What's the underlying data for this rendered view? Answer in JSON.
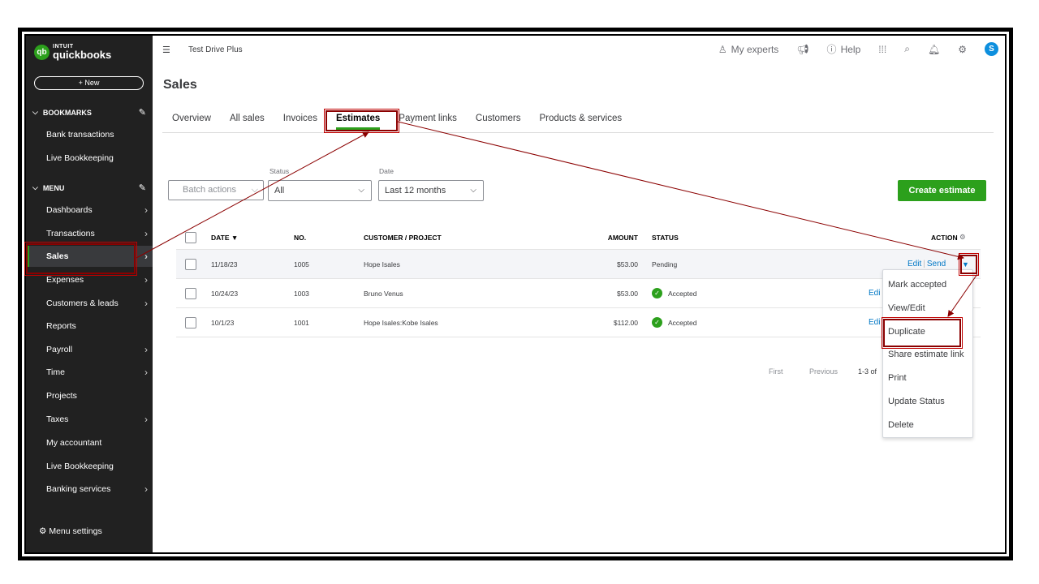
{
  "sidebar": {
    "brand_top": "INTUIT",
    "brand_name": "quickbooks",
    "brand_mark": "qb",
    "new_label": "+ New",
    "bookmarks_label": "BOOKMARKS",
    "bookmarks": [
      "Bank transactions",
      "Live Bookkeeping"
    ],
    "menu_label": "MENU",
    "items": [
      {
        "label": "Dashboards",
        "arrow": true
      },
      {
        "label": "Transactions",
        "arrow": true
      },
      {
        "label": "Sales",
        "arrow": true,
        "active": true
      },
      {
        "label": "Expenses",
        "arrow": true
      },
      {
        "label": "Customers & leads",
        "arrow": true
      },
      {
        "label": "Reports",
        "arrow": false
      },
      {
        "label": "Payroll",
        "arrow": true
      },
      {
        "label": "Time",
        "arrow": true
      },
      {
        "label": "Projects",
        "arrow": false
      },
      {
        "label": "Taxes",
        "arrow": true
      },
      {
        "label": "My accountant",
        "arrow": false
      },
      {
        "label": "Live Bookkeeping",
        "arrow": false
      },
      {
        "label": "Banking services",
        "arrow": true
      }
    ],
    "menu_settings": "Menu settings"
  },
  "topbar": {
    "company": "Test Drive Plus",
    "my_experts": "My experts",
    "help": "Help",
    "avatar_letter": "S"
  },
  "page": {
    "title": "Sales",
    "tabs": [
      "Overview",
      "All sales",
      "Invoices",
      "Estimates",
      "Payment links",
      "Customers",
      "Products & services"
    ],
    "active_tab": "Estimates"
  },
  "filters": {
    "batch_actions": "Batch actions",
    "status_label": "Status",
    "status_value": "All",
    "date_label": "Date",
    "date_value": "Last 12 months",
    "create_button": "Create estimate"
  },
  "table": {
    "headers": {
      "date": "DATE ▼",
      "no": "NO.",
      "customer": "CUSTOMER / PROJECT",
      "amount": "AMOUNT",
      "status": "STATUS",
      "action": "ACTION"
    },
    "rows": [
      {
        "date": "11/18/23",
        "no": "1005",
        "customer": "Hope Isales",
        "amount": "$53.00",
        "status": "Pending",
        "action": "Edit",
        "action2": "Send"
      },
      {
        "date": "10/24/23",
        "no": "1003",
        "customer": "Bruno Venus",
        "amount": "$53.00",
        "status": "Accepted",
        "action": "Edi"
      },
      {
        "date": "10/1/23",
        "no": "1001",
        "customer": "Hope Isales:Kobe Isales",
        "amount": "$112.00",
        "status": "Accepted",
        "action": "Edi"
      }
    ]
  },
  "pager": {
    "first": "First",
    "previous": "Previous",
    "range": "1-3 of"
  },
  "dropdown": {
    "items": [
      "Mark accepted",
      "View/Edit",
      "Duplicate",
      "Share estimate link",
      "Print",
      "Update Status",
      "Delete"
    ]
  },
  "colors": {
    "brand_green": "#2ca01c",
    "sidebar_bg": "#212121",
    "link_blue": "#0077c5",
    "annotation_red": "#8b0000"
  }
}
